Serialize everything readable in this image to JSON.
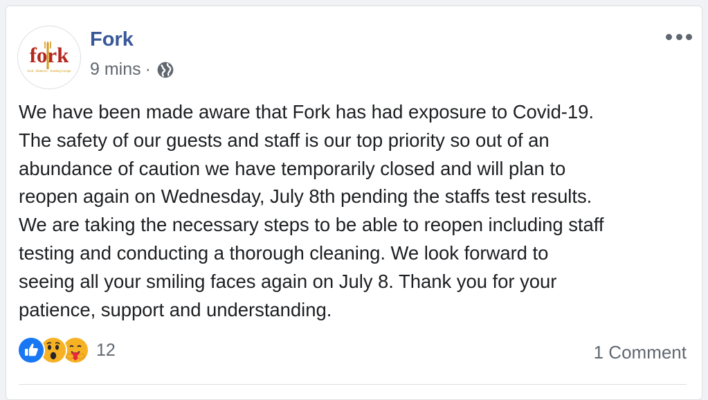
{
  "post": {
    "page_name": "Fork",
    "time": "9 mins",
    "separator": "·",
    "privacy_icon": "globe-icon",
    "more_icon": "more-options-icon",
    "avatar": {
      "logo_text": "fork",
      "tagline": "food · libations · bowling lounge",
      "colors": {
        "brand_red": "#b5281f",
        "brand_gold": "#d69a1c"
      }
    },
    "body_lines": [
      "We have been made aware that Fork has had exposure to Covid-19.",
      "The safety of our guests and staff is our top priority so out of an",
      "abundance of caution we have temporarily closed and will plan to",
      "reopen again on Wednesday, July 8th pending the staffs test results.",
      "We are taking the necessary steps to be able to reopen including staff",
      "testing and conducting a thorough cleaning. We look forward to",
      "seeing all your smiling faces again on July 8. Thank you for your",
      "patience, support and understanding."
    ],
    "reactions": {
      "icons": [
        "like-icon",
        "wow-icon",
        "care-icon"
      ],
      "count": "12"
    },
    "comments_label": "1 Comment"
  },
  "colors": {
    "link_blue": "#385898",
    "like_blue": "#1877f2",
    "secondary_text": "#606770",
    "body_text": "#1c1e21"
  }
}
